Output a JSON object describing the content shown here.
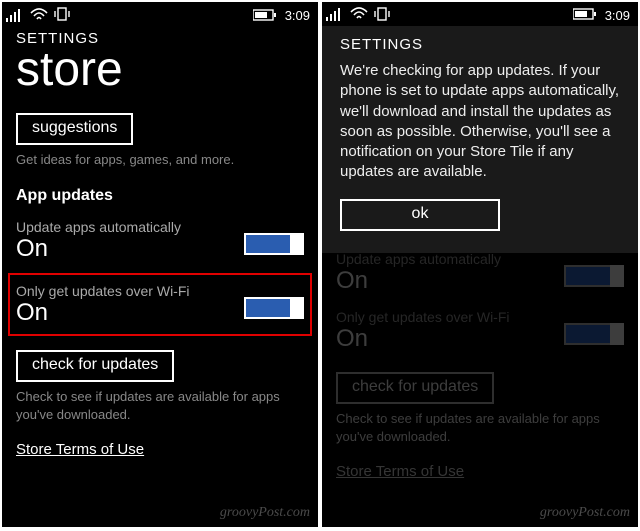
{
  "status": {
    "time": "3:09"
  },
  "left": {
    "headerSmall": "SETTINGS",
    "headerLarge": "store",
    "suggestionsBtn": "suggestions",
    "suggestionsHint": "Get ideas for apps, games, and more.",
    "sectionTitle": "App updates",
    "autoLabel": "Update apps automatically",
    "autoValue": "On",
    "wifiLabel": "Only get updates over Wi-Fi",
    "wifiValue": "On",
    "checkBtn": "check for updates",
    "checkHint": "Check to see if updates are available for apps you've downloaded.",
    "termsLink": "Store Terms of Use"
  },
  "right": {
    "headerSmall": "SETTINGS",
    "modalBody": "We're checking for app updates. If your phone is set to update apps automatically, we'll download and install the updates as soon as possible. Otherwise, you'll see a notification on your Store Tile if any updates are available.",
    "okBtn": "ok",
    "autoLabel": "Update apps automatically",
    "autoValue": "On",
    "wifiLabel": "Only get updates over Wi-Fi",
    "wifiValue": "On",
    "checkBtn": "check for updates",
    "checkHint": "Check to see if updates are available for apps you've downloaded.",
    "termsLink": "Store Terms of Use"
  },
  "watermark": "groovyPost.com"
}
